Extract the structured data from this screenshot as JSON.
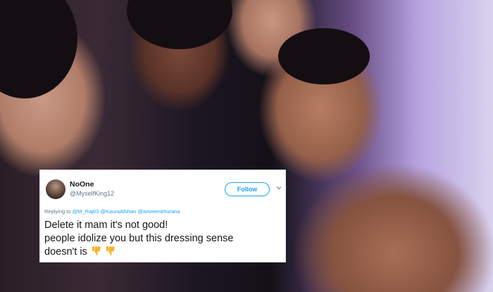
{
  "tweet": {
    "display_name": "NoOne",
    "handle": "@MyselfKing12",
    "follow_label": "Follow",
    "reply_prefix": "Replying to",
    "mentions": [
      "@M_Raj03",
      "@KauraAfshan",
      "@amreenkhurana"
    ],
    "text_line1": "Delete it mam it's not good!",
    "text_line2": "people idolize you but this dressing sense",
    "text_line3": "doesn't is",
    "emojis": [
      "thumbs-down-icon",
      "thumbs-down-icon"
    ]
  },
  "colors": {
    "accent": "#1da1f2",
    "name": "#14171a",
    "muted": "#657786",
    "emoji": "#f5b52a"
  }
}
